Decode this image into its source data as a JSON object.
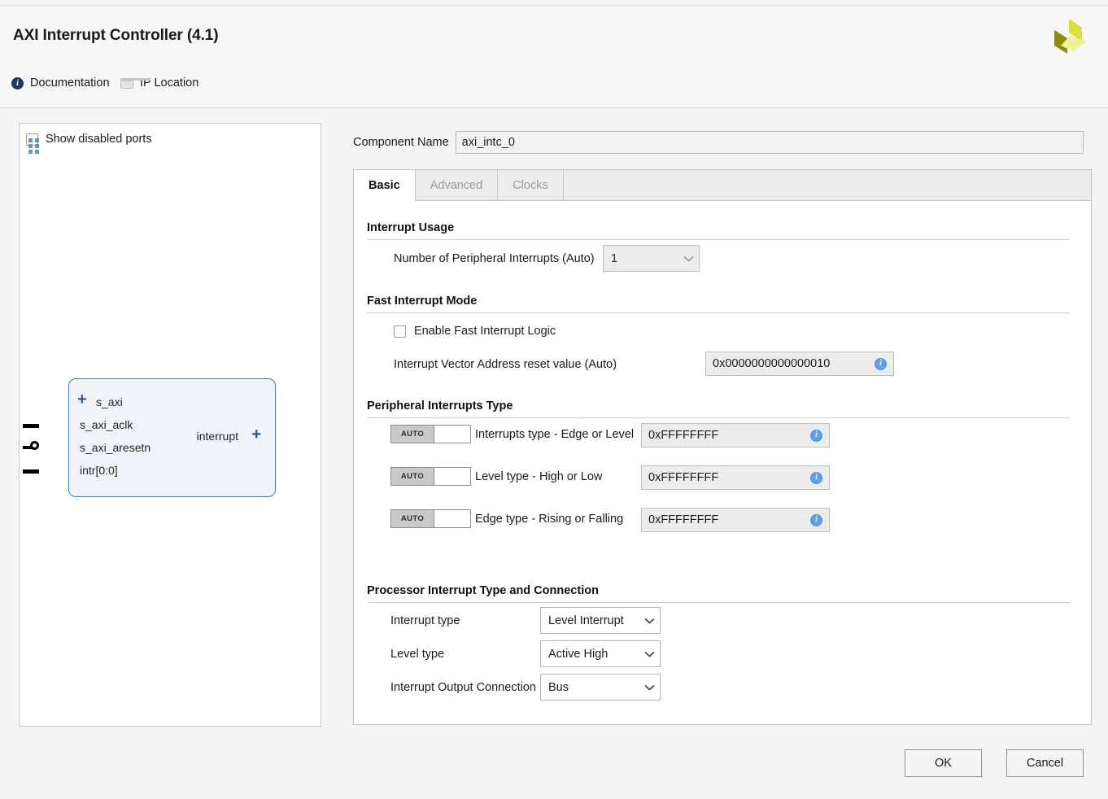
{
  "window": {
    "title": "AXI Interrupt Controller (4.1)",
    "logo_name": "xilinx-amd-logo",
    "logo_colors": [
      "#d8e040",
      "#8a8c12",
      "#eef09a"
    ]
  },
  "linkbar": {
    "documentation": "Documentation",
    "ip_location": "IP Location"
  },
  "diagram_panel": {
    "show_disabled_ports_label": "Show disabled ports",
    "show_disabled_ports_checked": false,
    "block": {
      "left_ports": [
        {
          "name": "s_axi",
          "kind": "bus",
          "expandable": true
        },
        {
          "name": "s_axi_aclk",
          "kind": "clock"
        },
        {
          "name": "s_axi_aresetn",
          "kind": "active-low"
        },
        {
          "name": "intr[0:0]",
          "kind": "signal"
        }
      ],
      "right_ports": [
        {
          "name": "interrupt",
          "kind": "bus",
          "expandable": true
        }
      ]
    }
  },
  "component": {
    "name_label": "Component Name",
    "name_value": "axi_intc_0"
  },
  "tabs": [
    {
      "label": "Basic",
      "active": true,
      "enabled": true
    },
    {
      "label": "Advanced",
      "active": false,
      "enabled": false
    },
    {
      "label": "Clocks",
      "active": false,
      "enabled": false
    }
  ],
  "sections": {
    "interrupt_usage": {
      "heading": "Interrupt Usage",
      "num_peripheral_interrupts": {
        "label": "Number of Peripheral Interrupts (Auto)",
        "value": "1",
        "enabled": false
      }
    },
    "fast_interrupt_mode": {
      "heading": "Fast Interrupt Mode",
      "enable_fast_interrupt_logic": {
        "label": "Enable Fast Interrupt Logic",
        "checked": false
      },
      "interrupt_vector_address": {
        "label": "Interrupt Vector Address reset value (Auto)",
        "value": "0x0000000000000010",
        "info_icon": "info-icon"
      }
    },
    "peripheral_interrupts_type": {
      "heading": "Peripheral Interrupts Type",
      "auto_badge": "AUTO",
      "rows": [
        {
          "label": "Interrupts type - Edge or Level",
          "value": "0xFFFFFFFF",
          "auto": true
        },
        {
          "label": "Level type - High or Low",
          "value": "0xFFFFFFFF",
          "auto": true
        },
        {
          "label": "Edge type - Rising or Falling",
          "value": "0xFFFFFFFF",
          "auto": true
        }
      ]
    },
    "processor_interrupt": {
      "heading": "Processor Interrupt Type and Connection",
      "rows": [
        {
          "label": "Interrupt type",
          "value": "Level Interrupt"
        },
        {
          "label": "Level type",
          "value": "Active High"
        },
        {
          "label": "Interrupt Output Connection",
          "value": "Bus"
        }
      ]
    }
  },
  "footer": {
    "ok": "OK",
    "cancel": "Cancel"
  }
}
